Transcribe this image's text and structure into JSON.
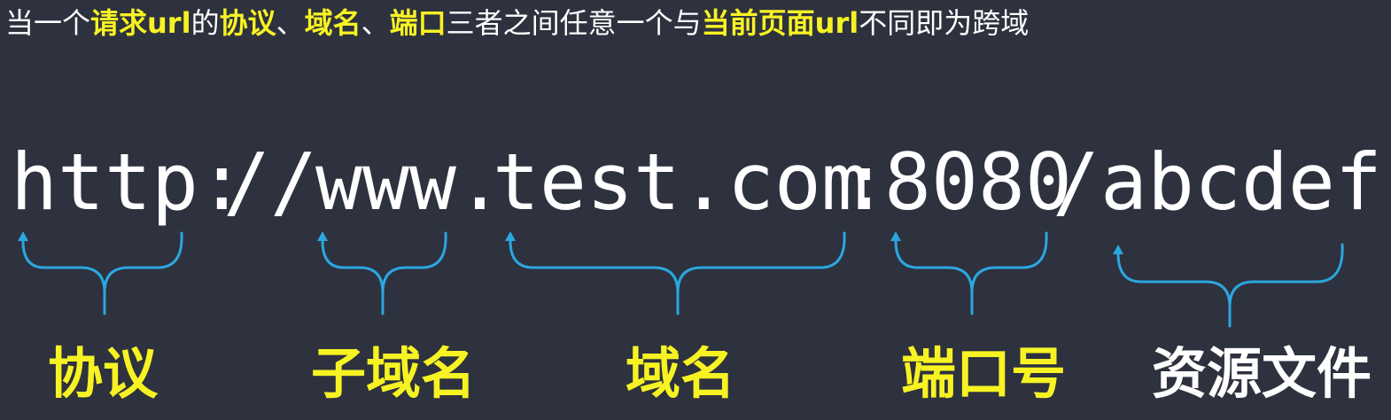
{
  "heading": {
    "seg1": "当一个",
    "seg2": "请求url",
    "seg3": "的",
    "seg4": "协议",
    "seg5": "、",
    "seg6": "域名",
    "seg7": "、",
    "seg8": "端口",
    "seg9": "三者之间任意一个与",
    "seg10": "当前页面url",
    "seg11": "不同即为跨域"
  },
  "url": {
    "protocol": "http:",
    "slashes": "//",
    "subdomain": "www.",
    "domain": "test.com",
    "colon": ":",
    "port": "8080",
    "slash": "/",
    "resource": "abcdef"
  },
  "labels": {
    "protocol": "协议",
    "subdomain": "子域名",
    "domain": "域名",
    "port": "端口号",
    "resource": "资源文件"
  },
  "colors": {
    "background": "#2e313e",
    "highlight": "#f7f323",
    "text": "#ffffff",
    "brace": "#2ba7e0"
  }
}
